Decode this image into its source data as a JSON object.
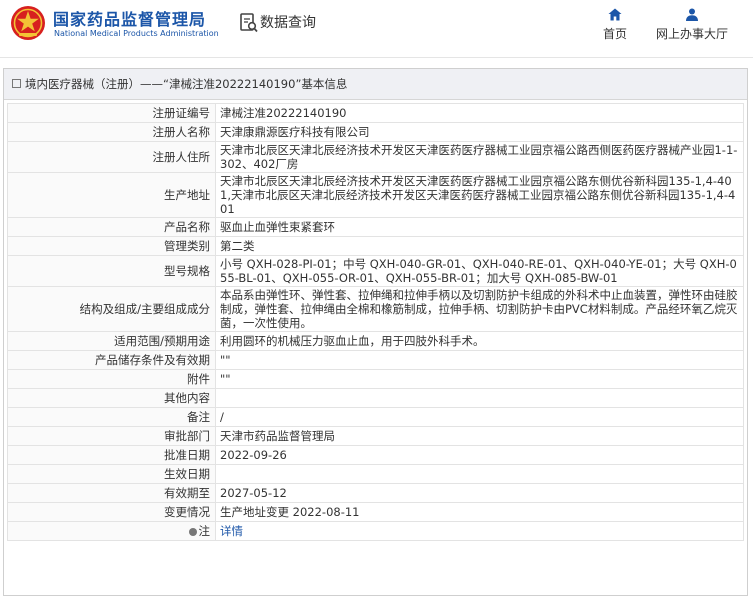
{
  "header": {
    "brand_cn": "国家药品监督管理局",
    "brand_en": "National Medical Products Administration",
    "query_label": "数据查询",
    "nav_home": "首页",
    "nav_office": "网上办事大厅"
  },
  "panel": {
    "title": "境内医疗器械（注册）——“津械注准20222140190”基本信息"
  },
  "rows": [
    {
      "label": "注册证编号",
      "value": "津械注准20222140190"
    },
    {
      "label": "注册人名称",
      "value": "天津康鼎源医疗科技有限公司"
    },
    {
      "label": "注册人住所",
      "value": "天津市北辰区天津北辰经济技术开发区天津医药医疗器械工业园京福公路西侧医药医疗器械产业园1-1-302、402厂房"
    },
    {
      "label": "生产地址",
      "value": "天津市北辰区天津北辰经济技术开发区天津医药医疗器械工业园京福公路东侧优谷新科园135-1,4-401,天津市北辰区天津北辰经济技术开发区天津医药医疗器械工业园京福公路东侧优谷新科园135-1,4-401"
    },
    {
      "label": "产品名称",
      "value": "驱血止血弹性束紧套环"
    },
    {
      "label": "管理类别",
      "value": "第二类"
    },
    {
      "label": "型号规格",
      "value": "小号 QXH-028-PI-01；中号 QXH-040-GR-01、QXH-040-RE-01、QXH-040-YE-01；大号 QXH-055-BL-01、QXH-055-OR-01、QXH-055-BR-01；加大号 QXH-085-BW-01"
    },
    {
      "label": "结构及组成/主要组成成分",
      "value": "本品系由弹性环、弹性套、拉伸绳和拉伸手柄以及切割防护卡组成的外科术中止血装置，弹性环由硅胶制成，弹性套、拉伸绳由全棉和橡筋制成，拉伸手柄、切割防护卡由PVC材料制成。产品经环氧乙烷灭菌，一次性使用。"
    },
    {
      "label": "适用范围/预期用途",
      "value": "利用圆环的机械压力驱血止血，用于四肢外科手术。"
    },
    {
      "label": "产品储存条件及有效期",
      "value": "\"\""
    },
    {
      "label": "附件",
      "value": "\"\""
    },
    {
      "label": "其他内容",
      "value": ""
    },
    {
      "label": "备注",
      "value": "/"
    },
    {
      "label": "审批部门",
      "value": "天津市药品监督管理局"
    },
    {
      "label": "批准日期",
      "value": "2022-09-26"
    },
    {
      "label": "生效日期",
      "value": ""
    },
    {
      "label": "有效期至",
      "value": "2027-05-12"
    },
    {
      "label": "变更情况",
      "value": "生产地址变更 2022-08-11"
    }
  ],
  "note": {
    "label": "注",
    "link": "详情"
  },
  "colors": {
    "brand_blue": "#1c56a8",
    "title_bg": "#eff0f4",
    "logo_red": "#d7201f",
    "logo_gold": "#f3c235"
  },
  "icons": {
    "logo": "emblem-icon",
    "query": "document-search-icon",
    "home": "home-icon",
    "office": "person-icon",
    "note": "bulb-icon"
  }
}
